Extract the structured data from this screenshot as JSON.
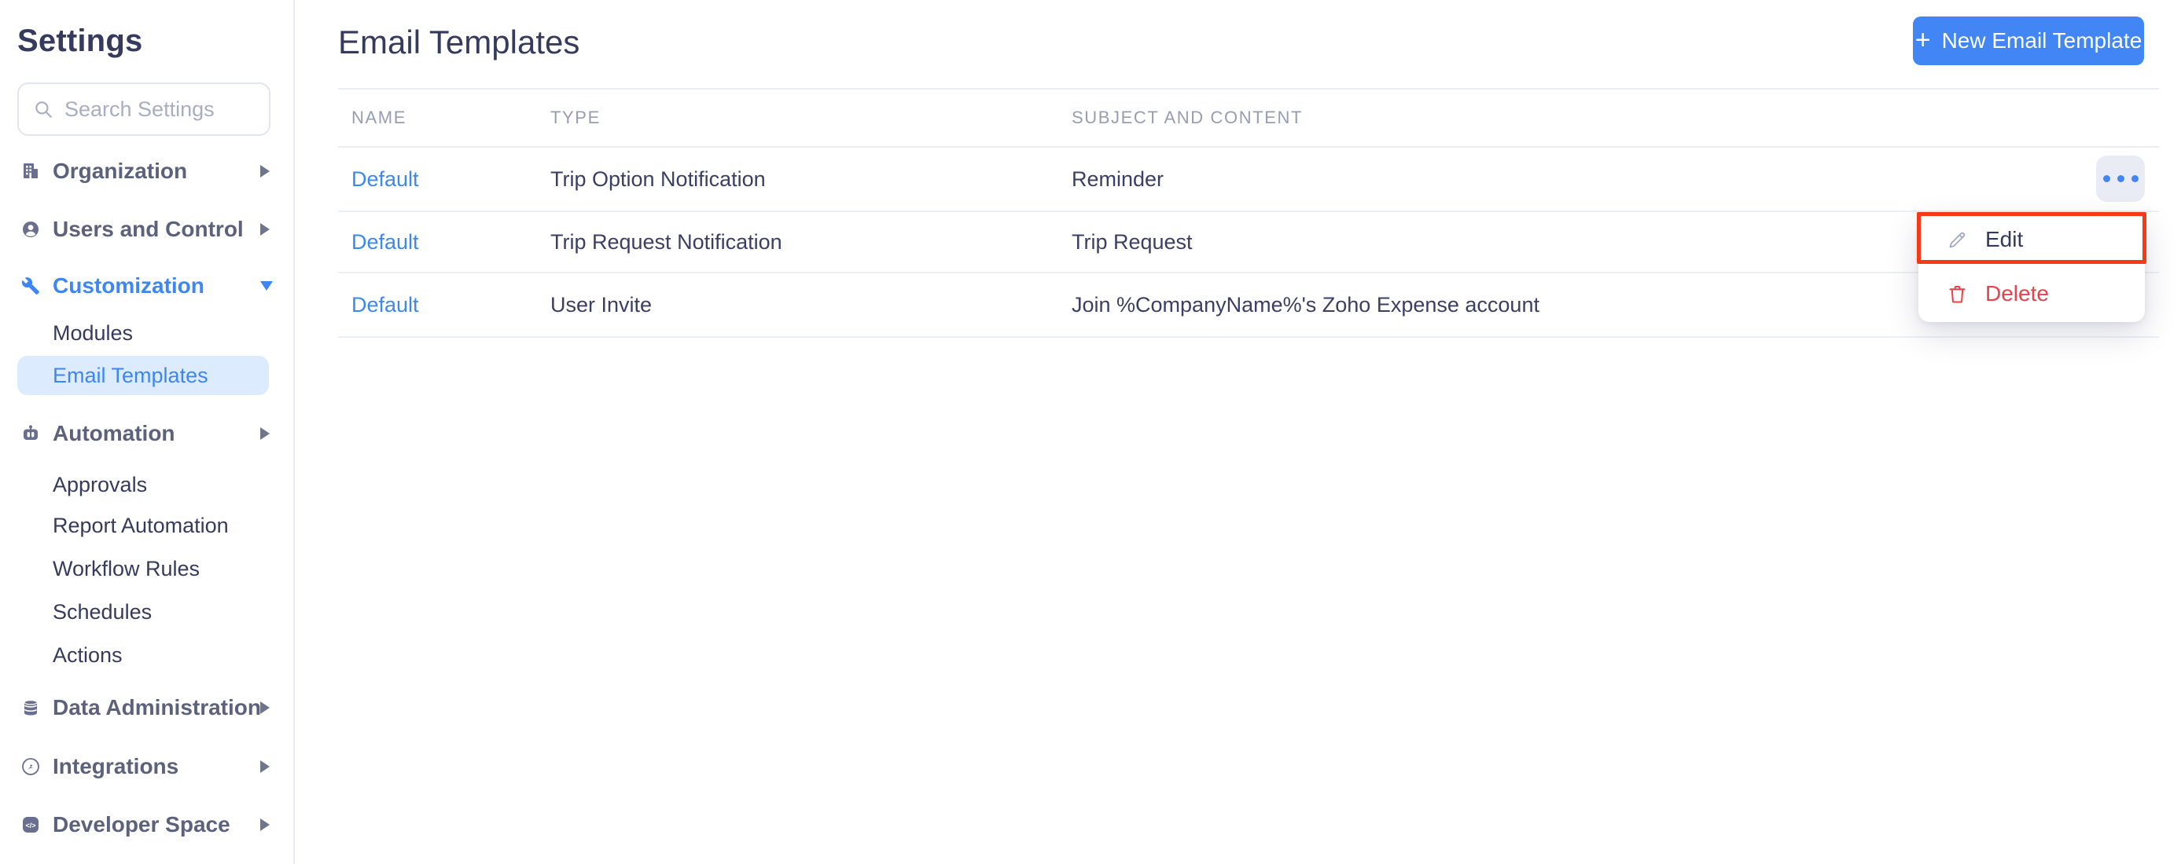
{
  "sidebar": {
    "title": "Settings",
    "search_placeholder": "Search Settings",
    "items": [
      {
        "label": "Organization",
        "icon": "building-icon",
        "chevron": "right",
        "level": "group"
      },
      {
        "label": "Users and Control",
        "icon": "user-icon",
        "chevron": "right",
        "level": "group"
      },
      {
        "label": "Customization",
        "icon": "wrench-icon",
        "chevron": "down",
        "level": "group",
        "active": true
      },
      {
        "label": "Modules",
        "level": "sub"
      },
      {
        "label": "Email Templates",
        "level": "sub",
        "selected": true
      },
      {
        "label": "Automation",
        "icon": "robot-icon",
        "chevron": "right",
        "level": "group"
      },
      {
        "label": "Approvals",
        "level": "sub"
      },
      {
        "label": "Report Automation",
        "level": "sub"
      },
      {
        "label": "Workflow Rules",
        "level": "sub"
      },
      {
        "label": "Schedules",
        "level": "sub"
      },
      {
        "label": "Actions",
        "level": "sub"
      },
      {
        "label": "Data Administration",
        "icon": "database-icon",
        "chevron": "right",
        "level": "group"
      },
      {
        "label": "Integrations",
        "icon": "integrations-icon",
        "chevron": "right",
        "level": "group"
      },
      {
        "label": "Developer Space",
        "icon": "code-icon",
        "chevron": "right",
        "level": "group"
      }
    ]
  },
  "main": {
    "title": "Email Templates",
    "new_button_label": "New Email Template",
    "new_button_plus": "+",
    "table": {
      "columns": [
        "NAME",
        "TYPE",
        "SUBJECT AND CONTENT"
      ],
      "rows": [
        {
          "name": "Default",
          "type": "Trip Option Notification",
          "subject": "Reminder"
        },
        {
          "name": "Default",
          "type": "Trip Request Notification",
          "subject": "Trip Request"
        },
        {
          "name": "Default",
          "type": "User Invite",
          "subject": "Join %CompanyName%'s Zoho Expense account"
        }
      ]
    },
    "row_menu": {
      "edit_label": "Edit",
      "delete_label": "Delete"
    }
  },
  "colors": {
    "accent_blue": "#3D87F5",
    "button_blue": "#4285F4",
    "active_pill_bg": "#DCEBFE",
    "delete_red": "#E8424D",
    "annotation_red": "#F43A16",
    "header_gray": "#989DB4",
    "icon_slate": "#6A6F8F"
  }
}
